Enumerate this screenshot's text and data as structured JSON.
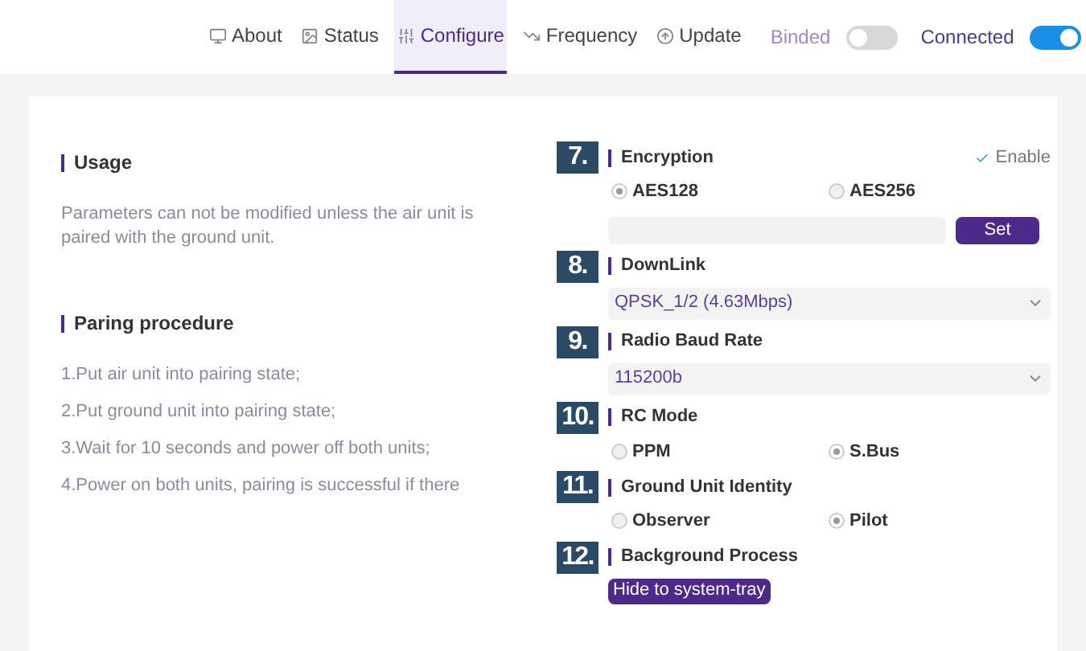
{
  "nav": {
    "tabs": [
      {
        "label": "About",
        "kind": "monitor",
        "selected": false
      },
      {
        "label": "Status",
        "kind": "status",
        "selected": false
      },
      {
        "label": "Configure",
        "kind": "sliders",
        "selected": true
      },
      {
        "label": "Frequency",
        "kind": "chart",
        "selected": false
      },
      {
        "label": "Update",
        "kind": "update",
        "selected": false
      }
    ],
    "toggles": [
      {
        "label": "Binded",
        "on": false
      },
      {
        "label": "Connected",
        "on": true
      }
    ]
  },
  "info": [
    {
      "title": "Usage",
      "lines": [
        "Parameters can not be modified unless the air unit is paired with the ground unit."
      ]
    },
    {
      "title": "Paring procedure",
      "lines": [
        "1.Put air unit into pairing state;",
        "2.Put ground unit into pairing state;",
        "3.Wait for 10 seconds and power off both units;",
        "4.Power on both units, pairing is successful if there"
      ]
    }
  ],
  "settings": [
    {
      "badge": "7.",
      "title": "Encryption",
      "kind": "encryption",
      "enable": {
        "label": "Enable",
        "checked": true
      },
      "options": [
        {
          "label": "AES128",
          "selected": true
        },
        {
          "label": "AES256",
          "selected": false
        }
      ],
      "button": "Set"
    },
    {
      "badge": "8.",
      "title": "DownLink",
      "kind": "dropdown",
      "value": "QPSK_1/2 (4.63Mbps)"
    },
    {
      "badge": "9.",
      "title": "Radio Baud Rate",
      "kind": "dropdown",
      "value": "115200b"
    },
    {
      "badge": "10.",
      "title": "RC Mode",
      "kind": "radio",
      "options": [
        {
          "label": "PPM",
          "selected": false
        },
        {
          "label": "S.Bus",
          "selected": true
        }
      ]
    },
    {
      "badge": "11.",
      "title": "Ground Unit Identity",
      "kind": "radio",
      "options": [
        {
          "label": "Observer",
          "selected": false
        },
        {
          "label": "Pilot",
          "selected": true
        }
      ]
    },
    {
      "badge": "12.",
      "title": "Background Process",
      "kind": "button",
      "button": "Hide to system-tray"
    }
  ]
}
